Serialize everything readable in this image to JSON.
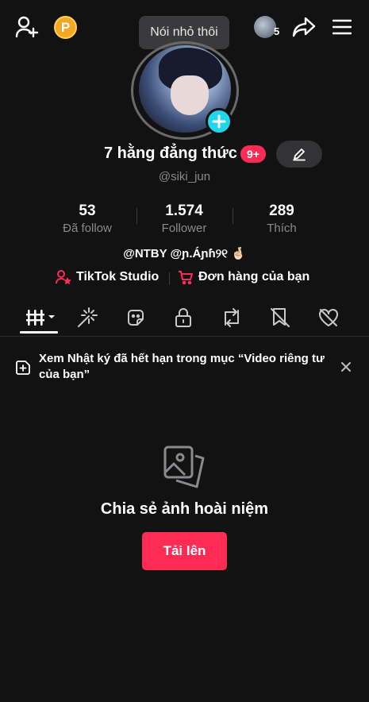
{
  "header": {
    "coin_letter": "P",
    "tooltip": "Nói nhỏ thôi",
    "friends_count": "5"
  },
  "profile": {
    "display_name": "7 hằng đẳng thức",
    "notif_badge": "9+",
    "username": "@siki_jun",
    "bio": "@NTBY @ɲ.Áɲɦ୨୧ 🤞🏻"
  },
  "stats": [
    {
      "value": "53",
      "label": "Đã follow"
    },
    {
      "value": "1.574",
      "label": "Follower"
    },
    {
      "value": "289",
      "label": "Thích"
    }
  ],
  "links": {
    "studio": "TikTok Studio",
    "orders": "Đơn hàng của bạn"
  },
  "notice": {
    "text": "Xem Nhật ký đã hết hạn trong mục “Video riêng tư của bạn”"
  },
  "empty_state": {
    "title": "Chia sẻ ảnh hoài niệm",
    "button": "Tải lên"
  },
  "colors": {
    "background": "#121212",
    "accent": "#fe2c55",
    "cyan": "#20d5ec",
    "coin": "#f5a623",
    "muted_text": "#8a8a8e"
  }
}
